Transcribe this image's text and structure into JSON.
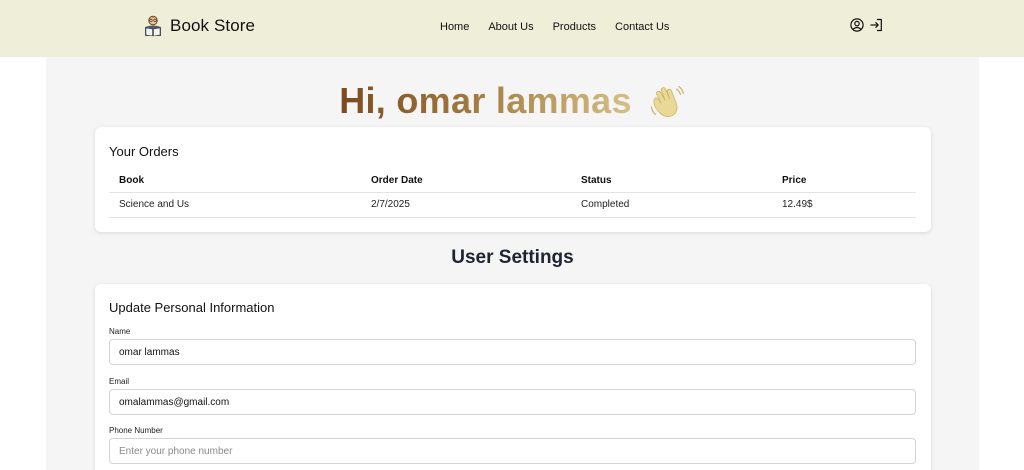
{
  "brand": {
    "name": "Book Store",
    "icon": "reader-icon"
  },
  "nav": {
    "links": [
      "Home",
      "About Us",
      "Products",
      "Contact Us"
    ],
    "icons": [
      "user-circle-icon",
      "sign-in-icon"
    ]
  },
  "greeting": {
    "text": "Hi, omar lammas",
    "icon": "waving-hand-icon"
  },
  "orders": {
    "title": "Your Orders",
    "columns": [
      "Book",
      "Order Date",
      "Status",
      "Price"
    ],
    "rows": [
      {
        "book": "Science and Us",
        "date": "2/7/2025",
        "status": "Completed",
        "price": "12.49$"
      }
    ]
  },
  "settings": {
    "heading": "User Settings",
    "card_title": "Update Personal Information",
    "fields": {
      "name": {
        "label": "Name",
        "value": "omar lammas",
        "placeholder": ""
      },
      "email": {
        "label": "Email",
        "value": "omalammas@gmail.com",
        "placeholder": ""
      },
      "phone": {
        "label": "Phone Number",
        "value": "",
        "placeholder": "Enter your phone number"
      }
    }
  },
  "colors": {
    "navbar_bg": "#eeeed9",
    "main_bg": "#f5f5f5",
    "status_completed": "#3a9a52",
    "greeting_start": "#7a4a1e",
    "greeting_end": "#d6c085"
  }
}
